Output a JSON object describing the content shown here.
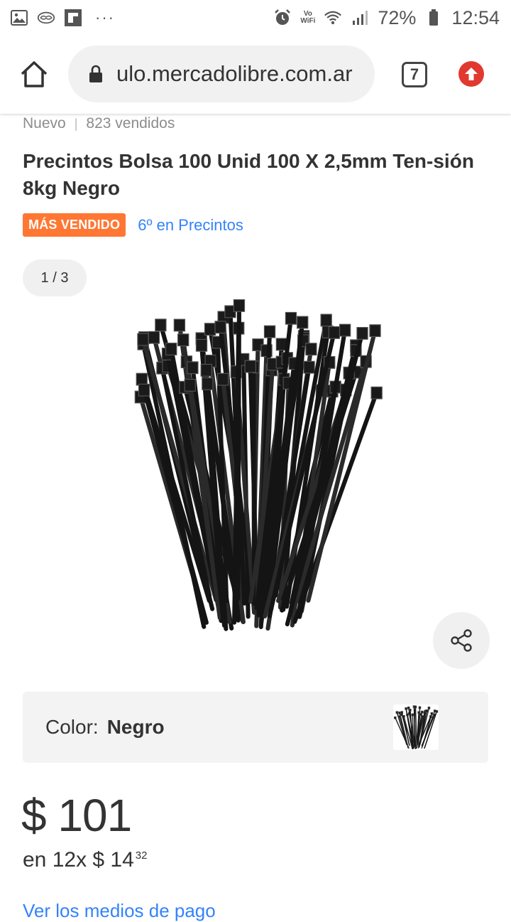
{
  "status_bar": {
    "battery_percent": "72%",
    "time": "12:54",
    "wifi_label_top": "Vo",
    "wifi_label_bottom": "WiFi",
    "dots": "···"
  },
  "browser": {
    "url": "ulo.mercadolibre.com.ar",
    "tab_count": "7"
  },
  "product": {
    "condition": "Nuevo",
    "sold": "823 vendidos",
    "title": "Precintos Bolsa 100 Unid 100 X 2,5mm Ten-sión 8kg Negro",
    "badge": "MÁS VENDIDO",
    "ranking": "6º en Precintos",
    "image_counter": "1 / 3",
    "color_label": "Color:",
    "color_value": "Negro",
    "price": "$ 101",
    "installments_prefix": "en 12x $ 14",
    "installments_cents": "32",
    "more_link": "Ver los medios de pago"
  },
  "colors": {
    "accent_blue": "#3483fa",
    "badge_orange": "#ff7733",
    "update_red": "#e1392f"
  }
}
